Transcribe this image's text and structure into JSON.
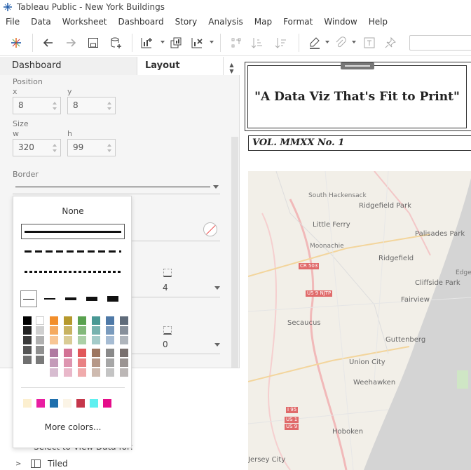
{
  "window": {
    "title": "Tableau Public - New York Buildings"
  },
  "menu": [
    "File",
    "Data",
    "Worksheet",
    "Dashboard",
    "Story",
    "Analysis",
    "Map",
    "Format",
    "Window",
    "Help"
  ],
  "toolbar": {
    "icons": [
      "tableau-logo-icon",
      "undo-icon",
      "redo-icon",
      "save-icon",
      "new-data-source-icon",
      "new-worksheet-icon",
      "duplicate-sheet-icon",
      "clear-sheet-icon",
      "swap-icon",
      "sort-ascending-icon",
      "sort-descending-icon",
      "highlight-icon",
      "attach-icon",
      "text-icon",
      "pin-icon"
    ]
  },
  "pane": {
    "tabs": {
      "dashboard": "Dashboard",
      "layout": "Layout"
    },
    "position": {
      "label": "Position",
      "x_label": "x",
      "y_label": "y",
      "x": "8",
      "y": "8"
    },
    "size": {
      "label": "Size",
      "w_label": "w",
      "h_label": "h",
      "w": "320",
      "h": "99"
    },
    "border": {
      "label": "Border"
    },
    "inner_padding_value": "4",
    "outer_padding_value": "0",
    "select_view_text": "Select to View Data for:",
    "tiled_label": "Tiled"
  },
  "border_popup": {
    "none_label": "None",
    "more_colors_label": "More colors...",
    "palette_colors": {
      "greys": [
        "#000000",
        "#222222",
        "#3a3a3a",
        "#555555",
        "#707070"
      ],
      "whites": [
        "#ffffff",
        "#d0d0d0",
        "#b0b0b0",
        "#909090",
        "#7a7a7a"
      ],
      "hues_top": [
        "#f28e2b",
        "#b6992d",
        "#59a14f",
        "#499894",
        "#4e79a7",
        "#5f6b7a"
      ],
      "hues_bottom": [
        "#b07aa1",
        "#d37295",
        "#e15759",
        "#9d7660",
        "#8a8a8a",
        "#79706e"
      ],
      "recent": [
        "#fcefcf",
        "#e91ea1",
        "#1f6fad",
        "#fbf4e6",
        "#c5374b",
        "#5ef0f0",
        "#e50d8a"
      ]
    }
  },
  "dashboard": {
    "title": "\"A Data Viz That's Fit to Print\"",
    "volume": "VOL. MMXX No. 1",
    "map_labels": [
      "South Hackensack",
      "Ridgefield Park",
      "Little Ferry",
      "Palisades Park",
      "Moonachie",
      "Ridgefield",
      "Edgewater",
      "Cliffside Park",
      "Fairview",
      "Secaucus",
      "Guttenberg",
      "Union City",
      "Weehawken",
      "Hoboken",
      "Jersey City"
    ],
    "road_shields": [
      "CR 503",
      "US 9 NJTP",
      "I 95",
      "US 1",
      "US 9"
    ]
  }
}
